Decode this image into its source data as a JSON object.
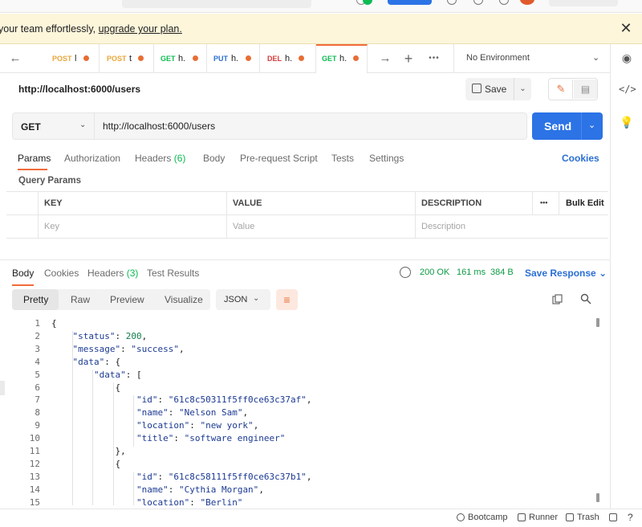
{
  "banner": {
    "text_before": "your team effortlessly, ",
    "link": "upgrade your plan."
  },
  "tabs": [
    {
      "method": "POST",
      "name": "l"
    },
    {
      "method": "POST",
      "name": "t"
    },
    {
      "method": "GET",
      "name": "h."
    },
    {
      "method": "PUT",
      "name": "h."
    },
    {
      "method": "DEL",
      "name": "h."
    },
    {
      "method": "GET",
      "name": "h."
    }
  ],
  "environment": "No Environment",
  "request": {
    "title": "http://localhost:6000/users",
    "method": "GET",
    "url": "http://localhost:6000/users",
    "save_label": "Save",
    "send_label": "Send"
  },
  "request_tabs": {
    "params": "Params",
    "authorization": "Authorization",
    "headers": "Headers",
    "headers_count": "(6)",
    "body": "Body",
    "prerequest": "Pre-request Script",
    "tests": "Tests",
    "settings": "Settings",
    "cookies": "Cookies"
  },
  "query_params": {
    "label": "Query Params",
    "headers": [
      "KEY",
      "VALUE",
      "DESCRIPTION"
    ],
    "more": "•••",
    "bulk_edit": "Bulk Edit",
    "placeholders": [
      "Key",
      "Value",
      "Description"
    ]
  },
  "response": {
    "tabs": {
      "body": "Body",
      "cookies": "Cookies",
      "headers": "Headers",
      "headers_count": "(3)",
      "test_results": "Test Results"
    },
    "status": "200 OK",
    "time": "161 ms",
    "size": "384 B",
    "save_response": "Save Response",
    "view_tabs": [
      "Pretty",
      "Raw",
      "Preview",
      "Visualize"
    ],
    "format": "JSON"
  },
  "code_lines": [
    {
      "n": "1",
      "text": "{"
    },
    {
      "n": "2",
      "text": "    \"status\": 200,"
    },
    {
      "n": "3",
      "text": "    \"message\": \"success\","
    },
    {
      "n": "4",
      "text": "    \"data\": {"
    },
    {
      "n": "5",
      "text": "        \"data\": ["
    },
    {
      "n": "6",
      "text": "            {"
    },
    {
      "n": "7",
      "text": "                \"id\": \"61c8c50311f5ff0ce63c37af\","
    },
    {
      "n": "8",
      "text": "                \"name\": \"Nelson Sam\","
    },
    {
      "n": "9",
      "text": "                \"location\": \"new york\","
    },
    {
      "n": "10",
      "text": "                \"title\": \"software engineer\""
    },
    {
      "n": "11",
      "text": "            },"
    },
    {
      "n": "12",
      "text": "            {"
    },
    {
      "n": "13",
      "text": "                \"id\": \"61c8c58111f5ff0ce63c37b1\","
    },
    {
      "n": "14",
      "text": "                \"name\": \"Cythia Morgan\","
    },
    {
      "n": "15",
      "text": "                \"location\": \"Berlin\""
    }
  ],
  "footer": {
    "bootcamp": "Bootcamp",
    "runner": "Runner",
    "trash": "Trash"
  },
  "colors": {
    "accent": "#f26b3a",
    "send": "#2c73e6",
    "status_ok": "#0c9b45",
    "banner_bg": "#fdf6db"
  }
}
